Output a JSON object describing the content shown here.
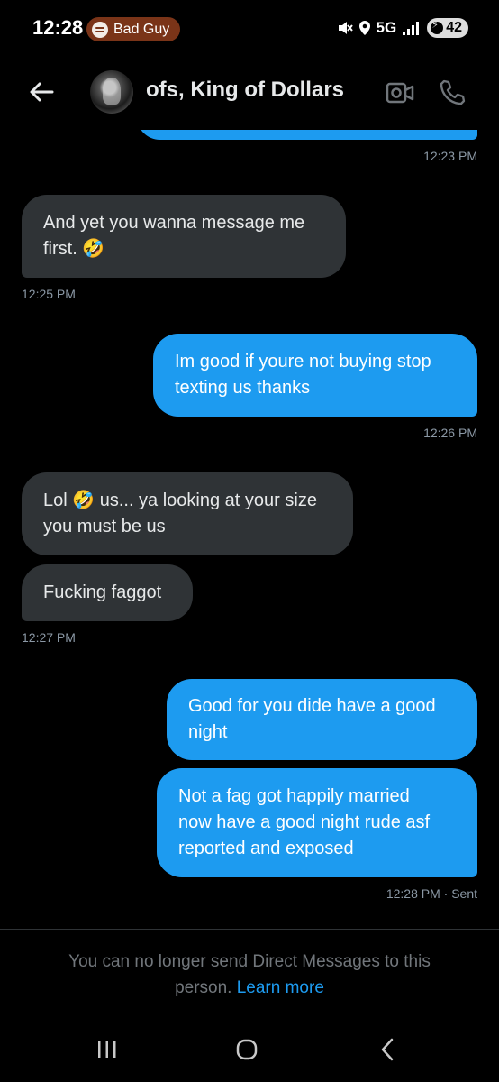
{
  "status_bar": {
    "time": "12:28",
    "now_playing": "Bad Guy",
    "network": "5G",
    "battery": "42"
  },
  "header": {
    "title": "ofs, King of Dollars"
  },
  "messages": [
    {
      "direction": "outgoing",
      "lines": [],
      "partial": true
    },
    {
      "timestamp": "12:23 PM"
    },
    {
      "direction": "incoming",
      "lines": [
        "And yet you wanna message me",
        "first. 🤣"
      ]
    },
    {
      "timestamp": "12:25 PM"
    },
    {
      "direction": "outgoing",
      "lines": [
        "Im good if youre not buying stop",
        "texting us thanks"
      ]
    },
    {
      "timestamp": "12:26 PM"
    },
    {
      "direction": "incoming",
      "lines": [
        "Lol 🤣 us... ya looking at your size",
        "you must be us"
      ]
    },
    {
      "direction": "incoming",
      "lines": [
        "Fucking faggot"
      ]
    },
    {
      "timestamp": "12:27 PM"
    },
    {
      "direction": "outgoing",
      "lines": [
        "Good for you dide have a good",
        "night"
      ]
    },
    {
      "direction": "outgoing",
      "lines": [
        "Not a fag got happily married",
        "now have a good night  rude asf",
        "reported and exposed"
      ]
    },
    {
      "timestamp": "12:28 PM · Sent"
    }
  ],
  "footer": {
    "notice_line1": "You can no longer send Direct Messages to this",
    "notice_line2_prefix": "person. ",
    "learn_more": "Learn more"
  },
  "colors": {
    "outgoing_bubble": "#1d9bf0",
    "incoming_bubble": "#2f3336",
    "background": "#000000",
    "link": "#1d9bf0"
  },
  "icons": [
    "back-arrow-icon",
    "video-call-icon",
    "phone-icon",
    "spotify-icon",
    "mute-icon",
    "location-icon",
    "signal-icon",
    "battery-icon",
    "nav-recents-icon",
    "nav-home-icon",
    "nav-back-icon"
  ]
}
